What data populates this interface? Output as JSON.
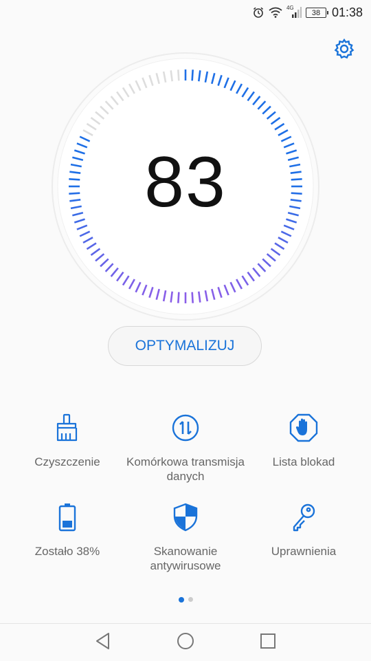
{
  "status_bar": {
    "network_label": "4G",
    "battery_level": "38",
    "time": "01:38",
    "icons": [
      "alarm-icon",
      "wifi-icon",
      "cellular-signal-icon",
      "battery-icon"
    ]
  },
  "header": {
    "settings_icon": "gear-icon"
  },
  "gauge": {
    "score": "83",
    "score_fraction": 0.83,
    "colors": {
      "active_start": "#1e6fe6",
      "active_end": "#8a5ee8",
      "inactive": "#dddddd"
    }
  },
  "optimize_button": {
    "label": "OPTYMALIZUJ"
  },
  "tools": [
    {
      "icon": "broom-icon",
      "label": "Czyszczenie"
    },
    {
      "icon": "data-transfer-icon",
      "label": "Komórkowa transmisja danych"
    },
    {
      "icon": "block-hand-icon",
      "label": "Lista blokad"
    },
    {
      "icon": "battery-status-icon",
      "label": "Zostało 38%"
    },
    {
      "icon": "shield-icon",
      "label": "Skanowanie antywirusowe"
    },
    {
      "icon": "key-icon",
      "label": "Uprawnienia"
    }
  ],
  "pager": {
    "pages": 2,
    "active": 0
  },
  "navigation": {
    "icons": [
      "back-icon",
      "home-icon",
      "recents-icon"
    ]
  },
  "colors": {
    "accent": "#1a73d9"
  }
}
